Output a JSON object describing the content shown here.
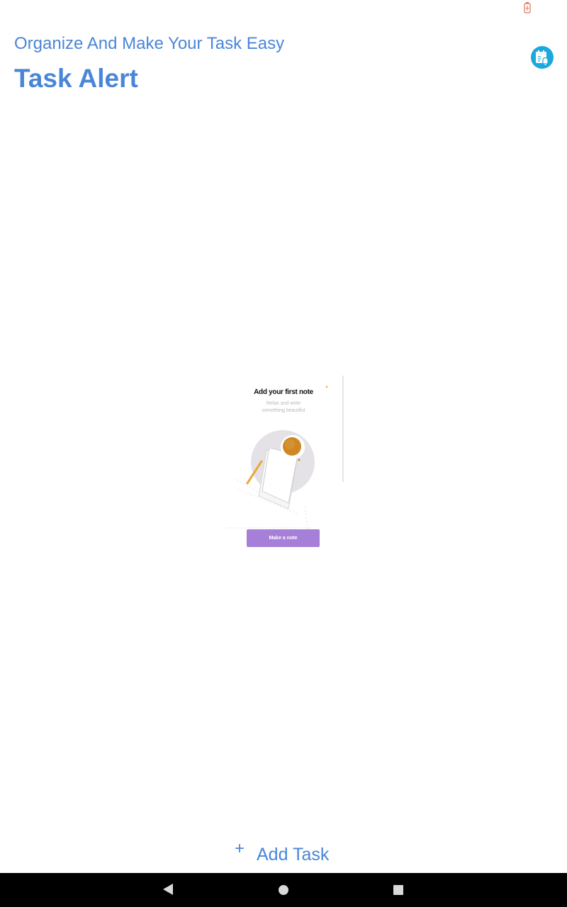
{
  "status_bar": {
    "battery_icon": "battery-charging-icon"
  },
  "header": {
    "subtitle": "Organize And Make Your Task Easy",
    "title": "Task Alert",
    "calendar_icon": "calendar-alarm-icon",
    "accent_color": "#4a86d8",
    "icon_color": "#1aa8dd"
  },
  "empty_state": {
    "heading": "Add your first note",
    "subtext_line1": "Relax and write",
    "subtext_line2": "something beautiful",
    "button_label": "Make a note",
    "button_color": "#a67fd9"
  },
  "footer": {
    "add_icon": "plus-icon",
    "add_task_label": "Add Task"
  },
  "nav_bar": {
    "back_icon": "back-triangle-icon",
    "home_icon": "home-circle-icon",
    "recents_icon": "recents-square-icon"
  }
}
